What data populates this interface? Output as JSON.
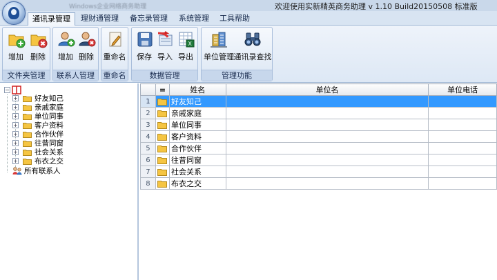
{
  "window": {
    "title": "欢迎使用实新精英商务助理  v 1.10 Build20150508  标准版",
    "blurred_caption": "Windows企业网络商务助理"
  },
  "tabs": [
    {
      "label": "通讯录管理",
      "active": true
    },
    {
      "label": "理财通管理",
      "active": false
    },
    {
      "label": "备忘录管理",
      "active": false
    },
    {
      "label": "系统管理",
      "active": false
    },
    {
      "label": "工具帮助",
      "active": false
    }
  ],
  "ribbon": {
    "groups": [
      {
        "label": "文件夹管理",
        "buttons": [
          {
            "label": "增加",
            "icon": "folder-add-icon"
          },
          {
            "label": "删除",
            "icon": "folder-delete-icon"
          }
        ]
      },
      {
        "label": "联系人管理",
        "buttons": [
          {
            "label": "增加",
            "icon": "user-add-icon"
          },
          {
            "label": "删除",
            "icon": "user-delete-icon"
          }
        ]
      },
      {
        "label": "重命名",
        "buttons": [
          {
            "label": "重命名",
            "icon": "rename-icon"
          }
        ]
      },
      {
        "label": "数据管理",
        "buttons": [
          {
            "label": "保存",
            "icon": "save-icon"
          },
          {
            "label": "导入",
            "icon": "import-icon"
          },
          {
            "label": "导出",
            "icon": "export-excel-icon"
          }
        ]
      },
      {
        "label": "管理功能",
        "buttons": [
          {
            "label": "单位管理",
            "icon": "building-icon"
          },
          {
            "label": "通讯录查找",
            "icon": "binoculars-icon"
          }
        ]
      }
    ]
  },
  "tree": {
    "root_icon": "address-book-icon",
    "folders": [
      "好友知己",
      "亲戚家庭",
      "单位同事",
      "客户资料",
      "合作伙伴",
      "往昔同窗",
      "社会关系",
      "布衣之交"
    ],
    "all_contacts": "所有联系人"
  },
  "grid": {
    "columns": [
      "=",
      "姓名",
      "单位名",
      "单位电话"
    ],
    "rows": [
      {
        "n": "1",
        "name": "好友知己",
        "org": "",
        "phone": "",
        "selected": true
      },
      {
        "n": "2",
        "name": "亲戚家庭",
        "org": "",
        "phone": "",
        "selected": false
      },
      {
        "n": "3",
        "name": "单位同事",
        "org": "",
        "phone": "",
        "selected": false
      },
      {
        "n": "4",
        "name": "客户资料",
        "org": "",
        "phone": "",
        "selected": false
      },
      {
        "n": "5",
        "name": "合作伙伴",
        "org": "",
        "phone": "",
        "selected": false
      },
      {
        "n": "6",
        "name": "往昔同窗",
        "org": "",
        "phone": "",
        "selected": false
      },
      {
        "n": "7",
        "name": "社会关系",
        "org": "",
        "phone": "",
        "selected": false
      },
      {
        "n": "8",
        "name": "布衣之交",
        "org": "",
        "phone": "",
        "selected": false
      }
    ]
  },
  "colors": {
    "selection": "#3399ff",
    "folder": "#f5c542",
    "ribbon_bg": "#dde8f5"
  }
}
